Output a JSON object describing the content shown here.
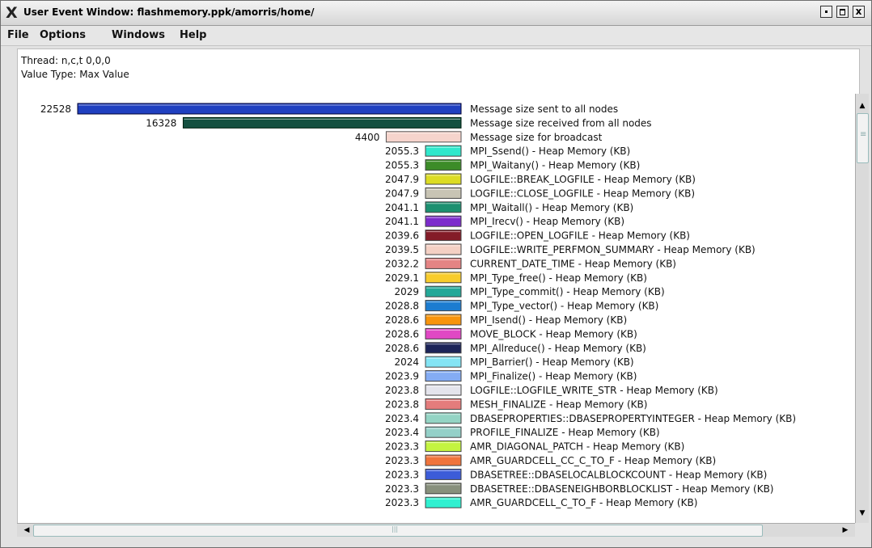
{
  "window": {
    "title": "User Event Window: flashmemory.ppk/amorris/home/",
    "app_icon": "x11-icon",
    "controls": {
      "minimize": "minimize-icon",
      "maximize": "maximize-icon",
      "close_symbol": "x"
    }
  },
  "menu": {
    "file": "File",
    "options": "Options",
    "windows": "Windows",
    "help": "Help"
  },
  "info": {
    "thread": "Thread: n,c,t 0,0,0",
    "value_type": "Value Type: Max Value"
  },
  "chart_data": {
    "type": "bar",
    "orientation": "horizontal",
    "xlim": [
      0,
      22528
    ],
    "rows": [
      {
        "label": "Message size sent to all nodes",
        "value": 22528,
        "value_text": "22528",
        "color": "#2040c0",
        "border": "#000030"
      },
      {
        "label": "Message size received from all nodes",
        "value": 16328,
        "value_text": "16328",
        "color": "#145040",
        "border": "#002010"
      },
      {
        "label": "Message size for broadcast",
        "value": 4400,
        "value_text": "4400",
        "color": "#f6d4cc",
        "border": "#555555"
      },
      {
        "label": "MPI_Ssend()  - Heap Memory (KB)",
        "value": 2055.3,
        "value_text": "2055.3",
        "color": "#30e8cc",
        "border": "#444444"
      },
      {
        "label": "MPI_Waitany()  - Heap Memory (KB)",
        "value": 2055.3,
        "value_text": "2055.3",
        "color": "#3c8c28",
        "border": "#444444"
      },
      {
        "label": "LOGFILE::BREAK_LOGFILE  - Heap Memory (KB)",
        "value": 2047.9,
        "value_text": "2047.9",
        "color": "#dcdc24",
        "border": "#444444"
      },
      {
        "label": "LOGFILE::CLOSE_LOGFILE  - Heap Memory (KB)",
        "value": 2047.9,
        "value_text": "2047.9",
        "color": "#c8c4b4",
        "border": "#444444"
      },
      {
        "label": "MPI_Waitall()  - Heap Memory (KB)",
        "value": 2041.1,
        "value_text": "2041.1",
        "color": "#1c9070",
        "border": "#444444"
      },
      {
        "label": "MPI_Irecv()  - Heap Memory (KB)",
        "value": 2041.1,
        "value_text": "2041.1",
        "color": "#7c2ccc",
        "border": "#444444"
      },
      {
        "label": "LOGFILE::OPEN_LOGFILE  - Heap Memory (KB)",
        "value": 2039.6,
        "value_text": "2039.6",
        "color": "#841c28",
        "border": "#444444"
      },
      {
        "label": "LOGFILE::WRITE_PERFMON_SUMMARY  - Heap Memory (KB)",
        "value": 2039.5,
        "value_text": "2039.5",
        "color": "#f4d0c4",
        "border": "#444444"
      },
      {
        "label": "CURRENT_DATE_TIME  - Heap Memory (KB)",
        "value": 2032.2,
        "value_text": "2032.2",
        "color": "#e48484",
        "border": "#444444"
      },
      {
        "label": "MPI_Type_free()  - Heap Memory (KB)",
        "value": 2029.1,
        "value_text": "2029.1",
        "color": "#f8cc2c",
        "border": "#444444"
      },
      {
        "label": "MPI_Type_commit()  - Heap Memory (KB)",
        "value": 2029,
        "value_text": "2029",
        "color": "#24a898",
        "border": "#444444"
      },
      {
        "label": "MPI_Type_vector()  - Heap Memory (KB)",
        "value": 2028.8,
        "value_text": "2028.8",
        "color": "#1c7cd0",
        "border": "#444444"
      },
      {
        "label": "MPI_Isend()  - Heap Memory (KB)",
        "value": 2028.6,
        "value_text": "2028.6",
        "color": "#f8940c",
        "border": "#444444"
      },
      {
        "label": "MOVE_BLOCK  - Heap Memory (KB)",
        "value": 2028.6,
        "value_text": "2028.6",
        "color": "#e048c4",
        "border": "#444444"
      },
      {
        "label": "MPI_Allreduce()  - Heap Memory (KB)",
        "value": 2028.6,
        "value_text": "2028.6",
        "color": "#1c2458",
        "border": "#444444"
      },
      {
        "label": "MPI_Barrier()  - Heap Memory (KB)",
        "value": 2024,
        "value_text": "2024",
        "color": "#84e4f4",
        "border": "#444444"
      },
      {
        "label": "MPI_Finalize()  - Heap Memory (KB)",
        "value": 2023.9,
        "value_text": "2023.9",
        "color": "#84acf4",
        "border": "#444444"
      },
      {
        "label": "LOGFILE::LOGFILE_WRITE_STR  - Heap Memory (KB)",
        "value": 2023.8,
        "value_text": "2023.8",
        "color": "#e4e4ec",
        "border": "#444444"
      },
      {
        "label": "MESH_FINALIZE  - Heap Memory (KB)",
        "value": 2023.8,
        "value_text": "2023.8",
        "color": "#e47c7c",
        "border": "#444444"
      },
      {
        "label": "DBASEPROPERTIES::DBASEPROPERTYINTEGER  - Heap Memory (KB)",
        "value": 2023.4,
        "value_text": "2023.4",
        "color": "#94d4c4",
        "border": "#444444"
      },
      {
        "label": "PROFILE_FINALIZE  - Heap Memory (KB)",
        "value": 2023.4,
        "value_text": "2023.4",
        "color": "#94d0c8",
        "border": "#444444"
      },
      {
        "label": "AMR_DIAGONAL_PATCH  - Heap Memory (KB)",
        "value": 2023.3,
        "value_text": "2023.3",
        "color": "#c4f440",
        "border": "#444444"
      },
      {
        "label": "AMR_GUARDCELL_CC_C_TO_F  - Heap Memory (KB)",
        "value": 2023.3,
        "value_text": "2023.3",
        "color": "#f0743c",
        "border": "#444444"
      },
      {
        "label": "DBASETREE::DBASELOCALBLOCKCOUNT  - Heap Memory (KB)",
        "value": 2023.3,
        "value_text": "2023.3",
        "color": "#3c5cd8",
        "border": "#444444"
      },
      {
        "label": "DBASETREE::DBASENEIGHBORBLOCKLIST  - Heap Memory (KB)",
        "value": 2023.3,
        "value_text": "2023.3",
        "color": "#88907c",
        "border": "#444444"
      },
      {
        "label": "AMR_GUARDCELL_C_TO_F  - Heap Memory (KB)",
        "value": 2023.3,
        "value_text": "2023.3",
        "color": "#30f0d0",
        "border": "#444444"
      }
    ]
  }
}
